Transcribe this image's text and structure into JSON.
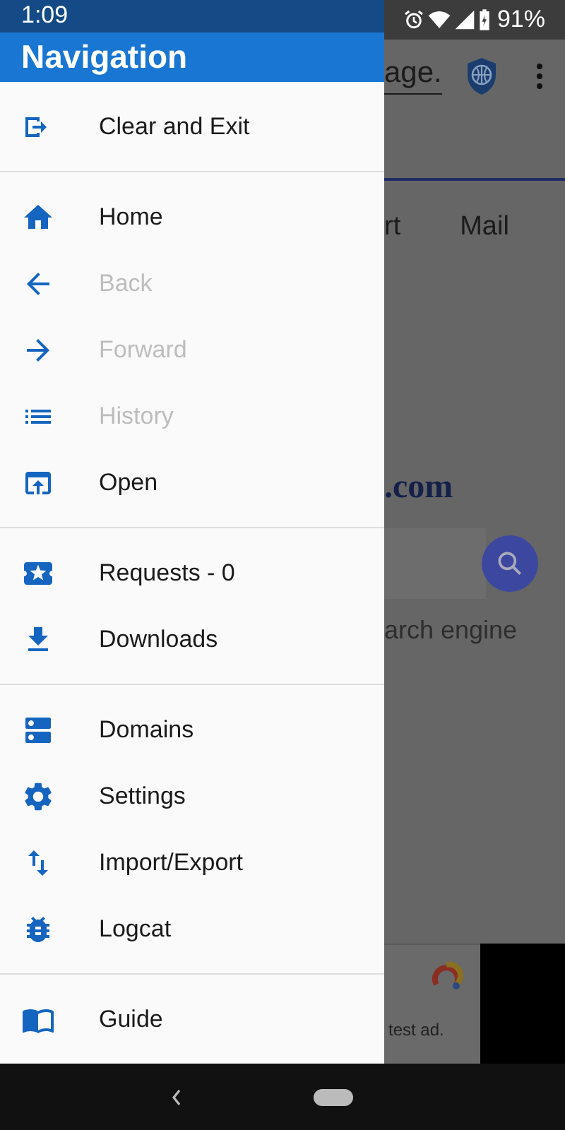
{
  "status_bar": {
    "time": "1:09",
    "battery": "91%"
  },
  "drawer": {
    "title": "Navigation",
    "groups": [
      {
        "items": [
          {
            "label": "Clear and Exit",
            "disabled": false
          }
        ]
      },
      {
        "items": [
          {
            "label": "Home",
            "disabled": false
          },
          {
            "label": "Back",
            "disabled": true
          },
          {
            "label": "Forward",
            "disabled": true
          },
          {
            "label": "History",
            "disabled": true
          },
          {
            "label": "Open",
            "disabled": false
          }
        ]
      },
      {
        "items": [
          {
            "label": "Requests - 0",
            "disabled": false
          },
          {
            "label": "Downloads",
            "disabled": false
          }
        ]
      },
      {
        "items": [
          {
            "label": "Domains",
            "disabled": false
          },
          {
            "label": "Settings",
            "disabled": false
          },
          {
            "label": "Import/Export",
            "disabled": false
          },
          {
            "label": "Logcat",
            "disabled": false
          }
        ]
      },
      {
        "items": [
          {
            "label": "Guide",
            "disabled": false
          }
        ]
      }
    ]
  },
  "page_behind": {
    "url": "age.",
    "tabs": [
      "rt",
      "Mail"
    ],
    "logo": ".com",
    "search_hint": "arch engine",
    "ad_text": "test ad."
  }
}
